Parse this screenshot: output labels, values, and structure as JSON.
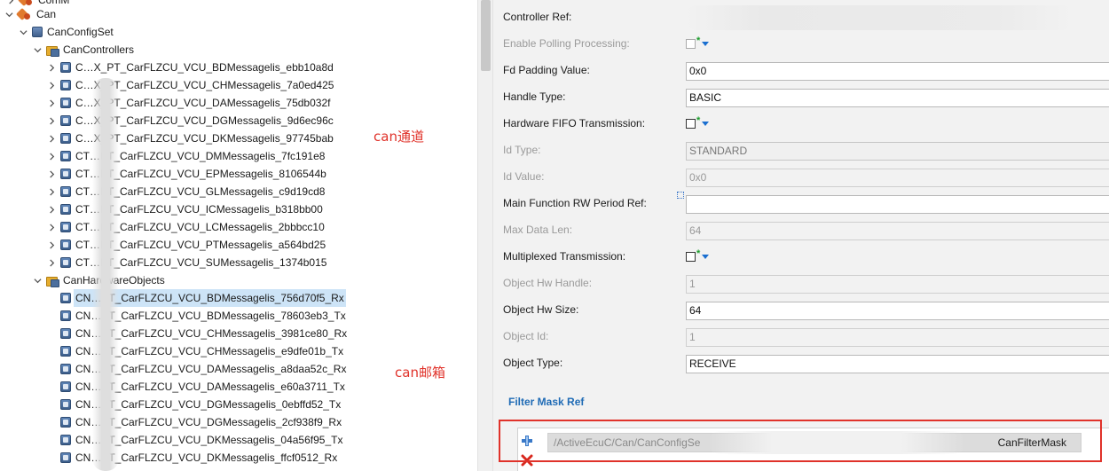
{
  "tree": {
    "top_partial_label": "ComM",
    "can_label": "Can",
    "config_set_label": "CanConfigSet",
    "controllers_folder_label": "CanControllers",
    "controllers": [
      "C…X_PT_CarFLZCU_VCU_BDMessagelis_ebb10a8d",
      "C…X_PT_CarFLZCU_VCU_CHMessagelis_7a0ed425",
      "C…X_PT_CarFLZCU_VCU_DAMessagelis_75db032f",
      "C…X_PT_CarFLZCU_VCU_DGMessagelis_9d6ec96c",
      "C…X_PT_CarFLZCU_VCU_DKMessagelis_97745bab",
      "CT…PT_CarFLZCU_VCU_DMMessagelis_7fc191e8",
      "CT…PT_CarFLZCU_VCU_EPMessagelis_8106544b",
      "CT…PT_CarFLZCU_VCU_GLMessagelis_c9d19cd8",
      "CT…PT_CarFLZCU_VCU_ICMessagelis_b318bb00",
      "CT…PT_CarFLZCU_VCU_LCMessagelis_2bbbcc10",
      "CT…PT_CarFLZCU_VCU_PTMessagelis_a564bd25",
      "CT…PT_CarFLZCU_VCU_SUMessagelis_1374b015"
    ],
    "hw_folder_label": "CanHardwareObjects",
    "hw_objects": [
      "CN…PT_CarFLZCU_VCU_BDMessagelis_756d70f5_Rx",
      "CN…PT_CarFLZCU_VCU_BDMessagelis_78603eb3_Tx",
      "CN…PT_CarFLZCU_VCU_CHMessagelis_3981ce80_Rx",
      "CN…PT_CarFLZCU_VCU_CHMessagelis_e9dfe01b_Tx",
      "CN…PT_CarFLZCU_VCU_DAMessagelis_a8daa52c_Rx",
      "CN…PT_CarFLZCU_VCU_DAMessagelis_e60a3711_Tx",
      "CN…PT_CarFLZCU_VCU_DGMessagelis_0ebffd52_Tx",
      "CN…PT_CarFLZCU_VCU_DGMessagelis_2cf938f9_Rx",
      "CN…PT_CarFLZCU_VCU_DKMessagelis_04a56f95_Tx",
      "CN…PT_CarFLZCU_VCU_DKMessagelis_ffcf0512_Rx"
    ],
    "annotation_controllers": "can通道",
    "annotation_mailboxes": "can邮箱"
  },
  "props": {
    "controller_ref_label": "Controller Ref:",
    "enable_polling_label": "Enable Polling Processing:",
    "fd_padding_label": "Fd Padding Value:",
    "fd_padding_value": "0x0",
    "handle_type_label": "Handle Type:",
    "handle_type_value": "BASIC",
    "hw_fifo_label": "Hardware FIFO Transmission:",
    "id_type_label": "Id Type:",
    "id_type_value": "STANDARD",
    "id_value_label": "Id Value:",
    "id_value_value": "0x0",
    "main_fn_label": "Main Function RW Period Ref:",
    "main_fn_value": "",
    "max_data_len_label": "Max Data Len:",
    "max_data_len_value": "64",
    "multiplexed_label": "Multiplexed Transmission:",
    "obj_hw_handle_label": "Object Hw Handle:",
    "obj_hw_handle_value": "1",
    "obj_hw_size_label": "Object Hw Size:",
    "obj_hw_size_value": "64",
    "obj_id_label": "Object Id:",
    "obj_id_value": "1",
    "obj_type_label": "Object Type:",
    "obj_type_value": "RECEIVE",
    "filter_title": "Filter Mask Ref",
    "filter_item_prefix": "/ActiveEcuC/Can/CanConfigSe",
    "filter_item_suffix": "CanFilterMask"
  },
  "colors": {
    "annotation_red": "#e0322a",
    "link_blue": "#1f6bb5",
    "selection": "#cde4f7"
  },
  "icons": {
    "expand": "chevron-down-icon",
    "collapse": "chevron-right-icon",
    "star": "asterisk-icon"
  }
}
